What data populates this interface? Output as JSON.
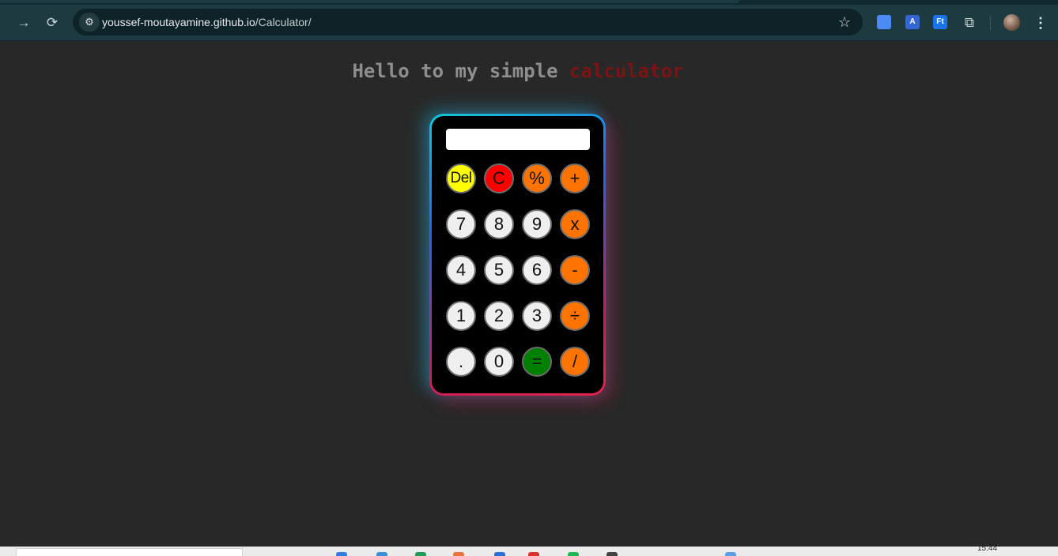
{
  "browser": {
    "url_host": "youssef-moutayamine.github.io",
    "url_path": "/Calculator/",
    "extensions": [
      {
        "name": "docs-extension",
        "color": "#4c8bf5",
        "glyph": ""
      },
      {
        "name": "translate-extension",
        "color": "#3367d6",
        "glyph": "A"
      },
      {
        "name": "font-extension",
        "color": "#1a73e8",
        "glyph": "Ft"
      }
    ]
  },
  "page": {
    "heading_prefix": "Hello to my simple",
    "heading_accent": "calculator",
    "accent_color": "#7a1414"
  },
  "calculator": {
    "display_value": "",
    "keys": [
      {
        "label": "Del",
        "kind": "del",
        "color": "#ffff00"
      },
      {
        "label": "C",
        "kind": "clear",
        "color": "#ff0000"
      },
      {
        "label": "%",
        "kind": "op",
        "color": "#ff7400"
      },
      {
        "label": "+",
        "kind": "op",
        "color": "#ff7400"
      },
      {
        "label": "7",
        "kind": "num"
      },
      {
        "label": "8",
        "kind": "num"
      },
      {
        "label": "9",
        "kind": "num"
      },
      {
        "label": "x",
        "kind": "op",
        "color": "#ff7400"
      },
      {
        "label": "4",
        "kind": "num"
      },
      {
        "label": "5",
        "kind": "num"
      },
      {
        "label": "6",
        "kind": "num"
      },
      {
        "label": "-",
        "kind": "op",
        "color": "#ff7400"
      },
      {
        "label": "1",
        "kind": "num"
      },
      {
        "label": "2",
        "kind": "num"
      },
      {
        "label": "3",
        "kind": "num"
      },
      {
        "label": "÷",
        "kind": "op",
        "color": "#ff7400"
      },
      {
        "label": ".",
        "kind": "num"
      },
      {
        "label": "0",
        "kind": "num"
      },
      {
        "label": "=",
        "kind": "eq",
        "color": "#008000"
      },
      {
        "label": "/",
        "kind": "op",
        "color": "#ff7400"
      }
    ]
  },
  "taskbar": {
    "clock": "15:44"
  }
}
